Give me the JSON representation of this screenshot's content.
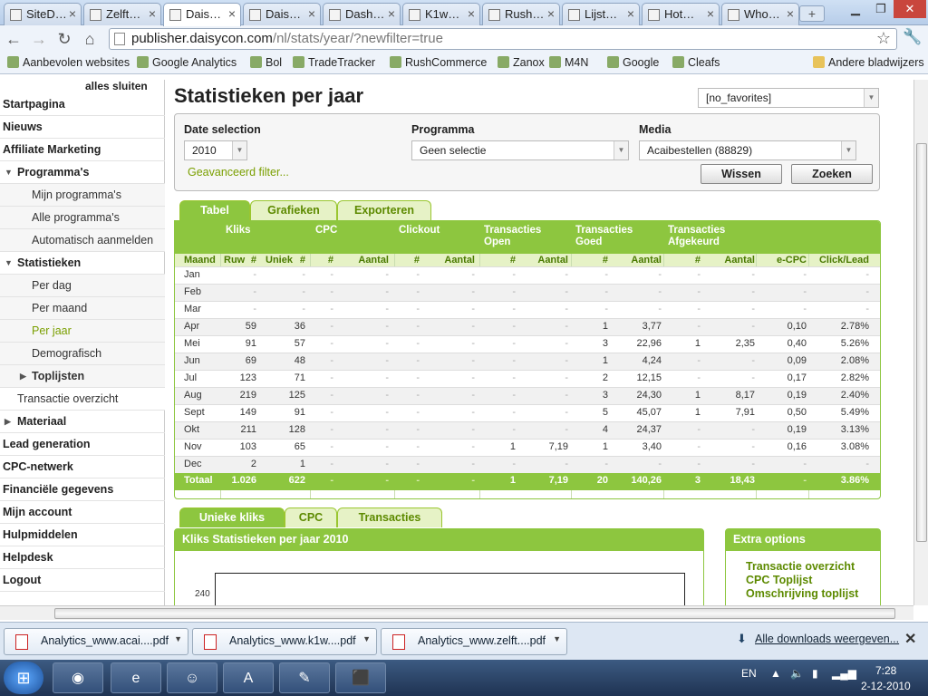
{
  "browser": {
    "tabs": [
      "SiteD…",
      "Zelft…",
      "Dais…",
      "Dais…",
      "Dash…",
      "K1w…",
      "Rush…",
      "Lijst…",
      "Hot…",
      "Who…"
    ],
    "active_tab": 2,
    "url_host": "publisher.daisycon.com",
    "url_path": "/nl/stats/year/?newfilter=true",
    "bookmarks": [
      "Aanbevolen websites",
      "Google Analytics",
      "Bol",
      "TradeTracker",
      "RushCommerce",
      "Zanox",
      "M4N",
      "Google",
      "Cleafs"
    ],
    "other_bookmarks": "Andere bladwijzers"
  },
  "sidebar": {
    "close_all": "alles sluiten",
    "items": [
      {
        "label": "Startpagina",
        "type": "top"
      },
      {
        "label": "Nieuws",
        "type": "top"
      },
      {
        "label": "Affiliate Marketing",
        "type": "top"
      },
      {
        "label": "Programma's",
        "type": "lvl1",
        "tri": "▼"
      },
      {
        "label": "Mijn programma's",
        "type": "sub"
      },
      {
        "label": "Alle programma's",
        "type": "sub"
      },
      {
        "label": "Automatisch aanmelden",
        "type": "sub"
      },
      {
        "label": "Statistieken",
        "type": "lvl1",
        "tri": "▼"
      },
      {
        "label": "Per dag",
        "type": "sub"
      },
      {
        "label": "Per maand",
        "type": "sub"
      },
      {
        "label": "Per jaar",
        "type": "sub",
        "active": true
      },
      {
        "label": "Demografisch",
        "type": "sub"
      },
      {
        "label": "Toplijsten",
        "type": "sub",
        "tri": "▶",
        "bold": true
      },
      {
        "label": "Transactie overzicht",
        "type": "plain"
      },
      {
        "label": "Materiaal",
        "type": "lvl1",
        "tri": "▶"
      },
      {
        "label": "Lead generation",
        "type": "top"
      },
      {
        "label": "CPC-netwerk",
        "type": "top"
      },
      {
        "label": "Financiële gegevens",
        "type": "top"
      },
      {
        "label": "Mijn account",
        "type": "top"
      },
      {
        "label": "Hulpmiddelen",
        "type": "top"
      },
      {
        "label": "Helpdesk",
        "type": "top"
      },
      {
        "label": "Logout",
        "type": "top"
      }
    ]
  },
  "page": {
    "title": "Statistieken per jaar",
    "favorites_value": "[no_favorites]"
  },
  "filter": {
    "date_label": "Date selection",
    "date_value": "2010",
    "programma_label": "Programma",
    "programma_value": "Geen selectie",
    "media_label": "Media",
    "media_value": "Acaibestellen (88829)",
    "advanced_link": "Geavanceerd filter...",
    "clear_button": "Wissen",
    "search_button": "Zoeken"
  },
  "table_tabs": [
    "Tabel",
    "Grafieken",
    "Exporteren"
  ],
  "table": {
    "group_headers": [
      "Kliks",
      "CPC",
      "Clickout",
      "Transacties Open",
      "Transacties Goed",
      "Transacties Afgekeurd"
    ],
    "columns": [
      "Maand",
      "Ruw",
      "#",
      "Uniek",
      "#",
      "#",
      "Aantal",
      "#",
      "Aantal",
      "#",
      "Aantal",
      "#",
      "Aantal",
      "#",
      "Aantal",
      "e-CPC",
      "Click/Lead"
    ],
    "rows": [
      [
        "Jan",
        "-",
        "-",
        "-",
        "-",
        "-",
        "-",
        "-",
        "-",
        "-",
        "-",
        "-",
        "-",
        "-",
        "-"
      ],
      [
        "Feb",
        "-",
        "-",
        "-",
        "-",
        "-",
        "-",
        "-",
        "-",
        "-",
        "-",
        "-",
        "-",
        "-",
        "-"
      ],
      [
        "Mar",
        "-",
        "-",
        "-",
        "-",
        "-",
        "-",
        "-",
        "-",
        "-",
        "-",
        "-",
        "-",
        "-",
        "-"
      ],
      [
        "Apr",
        "59",
        "36",
        "-",
        "-",
        "-",
        "-",
        "-",
        "-",
        "1",
        "3,77",
        "-",
        "-",
        "0,10",
        "2.78%"
      ],
      [
        "Mei",
        "91",
        "57",
        "-",
        "-",
        "-",
        "-",
        "-",
        "-",
        "3",
        "22,96",
        "1",
        "2,35",
        "0,40",
        "5.26%"
      ],
      [
        "Jun",
        "69",
        "48",
        "-",
        "-",
        "-",
        "-",
        "-",
        "-",
        "1",
        "4,24",
        "-",
        "-",
        "0,09",
        "2.08%"
      ],
      [
        "Jul",
        "123",
        "71",
        "-",
        "-",
        "-",
        "-",
        "-",
        "-",
        "2",
        "12,15",
        "-",
        "-",
        "0,17",
        "2.82%"
      ],
      [
        "Aug",
        "219",
        "125",
        "-",
        "-",
        "-",
        "-",
        "-",
        "-",
        "3",
        "24,30",
        "1",
        "8,17",
        "0,19",
        "2.40%"
      ],
      [
        "Sept",
        "149",
        "91",
        "-",
        "-",
        "-",
        "-",
        "-",
        "-",
        "5",
        "45,07",
        "1",
        "7,91",
        "0,50",
        "5.49%"
      ],
      [
        "Okt",
        "211",
        "128",
        "-",
        "-",
        "-",
        "-",
        "-",
        "-",
        "4",
        "24,37",
        "-",
        "-",
        "0,19",
        "3.13%"
      ],
      [
        "Nov",
        "103",
        "65",
        "-",
        "-",
        "-",
        "-",
        "1",
        "7,19",
        "1",
        "3,40",
        "-",
        "-",
        "0,16",
        "3.08%"
      ],
      [
        "Dec",
        "2",
        "1",
        "-",
        "-",
        "-",
        "-",
        "-",
        "-",
        "-",
        "-",
        "-",
        "-",
        "-",
        "-"
      ]
    ],
    "total": [
      "Totaal",
      "1.026",
      "622",
      "-",
      "-",
      "-",
      "-",
      "1",
      "7,19",
      "20",
      "140,26",
      "3",
      "18,43",
      "-",
      "3.86%"
    ]
  },
  "chart_tabs": [
    "Unieke kliks",
    "CPC",
    "Transacties"
  ],
  "chart_panel": {
    "title": "Kliks Statistieken per jaar 2010",
    "ytick": "240"
  },
  "extra": {
    "title": "Extra options",
    "links": [
      "Transactie overzicht",
      "CPC Toplijst",
      "Omschrijving toplijst"
    ]
  },
  "downloads": {
    "files": [
      "Analytics_www.acai....pdf",
      "Analytics_www.k1w....pdf",
      "Analytics_www.zelft....pdf"
    ],
    "all_link": "Alle downloads weergeven..."
  },
  "taskbar": {
    "lang": "EN",
    "time": "7:28",
    "date": "2-12-2010"
  }
}
